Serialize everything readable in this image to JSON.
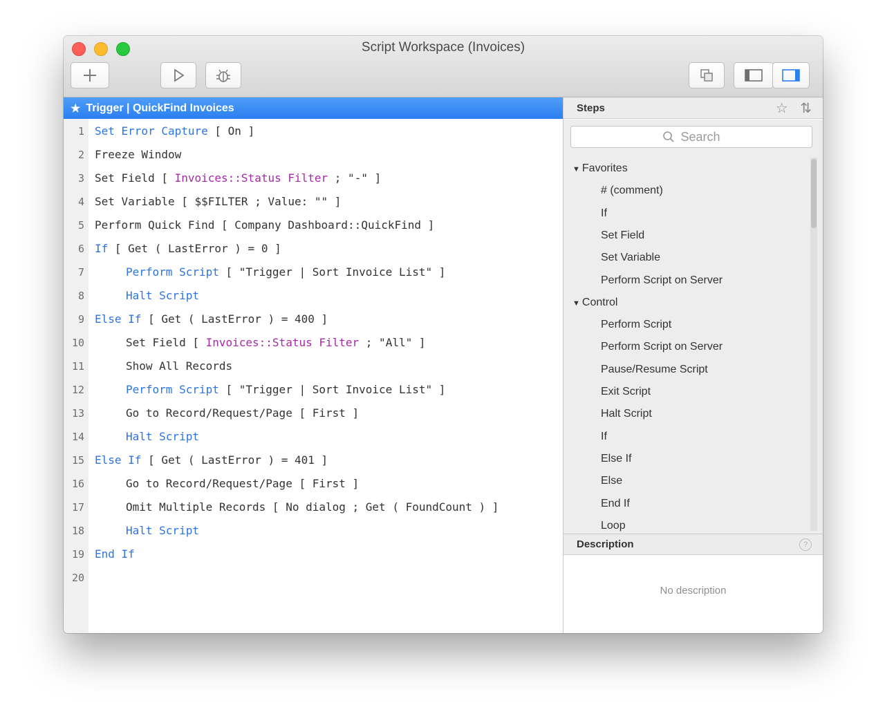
{
  "window": {
    "title": "Script Workspace (Invoices)"
  },
  "toolbar": {
    "new_script_icon": "plus-icon",
    "run_icon": "play-icon",
    "debug_icon": "debug-bug-icon",
    "copy_icon": "copy-icon",
    "left_panel_icon": "left-panel-icon",
    "right_panel_icon": "right-panel-icon"
  },
  "editor": {
    "tab_title": "Trigger | QuickFind Invoices",
    "lines": [
      {
        "n": "1",
        "indent": 0,
        "parts": [
          {
            "t": "Set Error Capture",
            "c": "kw"
          },
          {
            "t": " [ On ]",
            "c": ""
          }
        ]
      },
      {
        "n": "2",
        "indent": 0,
        "parts": [
          {
            "t": "Freeze Window",
            "c": ""
          }
        ]
      },
      {
        "n": "3",
        "indent": 0,
        "parts": [
          {
            "t": "Set Field [ ",
            "c": ""
          },
          {
            "t": "Invoices::Status Filter",
            "c": "fld"
          },
          {
            "t": " ; \"-\" ]",
            "c": ""
          }
        ]
      },
      {
        "n": "4",
        "indent": 0,
        "parts": [
          {
            "t": "Set Variable [ $$FILTER ; Value: \"\" ]",
            "c": ""
          }
        ]
      },
      {
        "n": "5",
        "indent": 0,
        "parts": [
          {
            "t": "Perform Quick Find [ Company Dashboard::QuickFind ]",
            "c": ""
          }
        ]
      },
      {
        "n": "6",
        "indent": 0,
        "parts": [
          {
            "t": "If",
            "c": "kw"
          },
          {
            "t": " [ Get ( LastError ) = 0 ]",
            "c": ""
          }
        ]
      },
      {
        "n": "7",
        "indent": 1,
        "parts": [
          {
            "t": "Perform Script",
            "c": "kw"
          },
          {
            "t": " [ \"Trigger | Sort Invoice List\" ]",
            "c": ""
          }
        ]
      },
      {
        "n": "8",
        "indent": 1,
        "parts": [
          {
            "t": "Halt Script",
            "c": "kw"
          }
        ]
      },
      {
        "n": "9",
        "indent": 0,
        "parts": [
          {
            "t": "Else If",
            "c": "kw"
          },
          {
            "t": " [ Get ( LastError ) = 400 ]",
            "c": ""
          }
        ]
      },
      {
        "n": "10",
        "indent": 1,
        "parts": [
          {
            "t": "Set Field [ ",
            "c": ""
          },
          {
            "t": "Invoices::Status Filter",
            "c": "fld"
          },
          {
            "t": " ; \"All\" ]",
            "c": ""
          }
        ]
      },
      {
        "n": "11",
        "indent": 1,
        "parts": [
          {
            "t": "Show All Records",
            "c": ""
          }
        ]
      },
      {
        "n": "12",
        "indent": 1,
        "parts": [
          {
            "t": "Perform Script",
            "c": "kw"
          },
          {
            "t": " [ \"Trigger | Sort Invoice List\" ]",
            "c": ""
          }
        ]
      },
      {
        "n": "13",
        "indent": 1,
        "parts": [
          {
            "t": "Go to Record/Request/Page [ First ]",
            "c": ""
          }
        ]
      },
      {
        "n": "14",
        "indent": 1,
        "parts": [
          {
            "t": "Halt Script",
            "c": "kw"
          }
        ]
      },
      {
        "n": "15",
        "indent": 0,
        "parts": [
          {
            "t": "Else If",
            "c": "kw"
          },
          {
            "t": " [ Get ( LastError ) = 401 ]",
            "c": ""
          }
        ]
      },
      {
        "n": "16",
        "indent": 1,
        "parts": [
          {
            "t": "Go to Record/Request/Page [ First ]",
            "c": ""
          }
        ]
      },
      {
        "n": "17",
        "indent": 1,
        "parts": [
          {
            "t": "Omit Multiple Records [ No dialog ; Get ( FoundCount ) ]",
            "c": ""
          }
        ]
      },
      {
        "n": "18",
        "indent": 1,
        "parts": [
          {
            "t": "Halt Script",
            "c": "kw"
          }
        ]
      },
      {
        "n": "19",
        "indent": 0,
        "parts": [
          {
            "t": "End If",
            "c": "kw"
          }
        ]
      },
      {
        "n": "20",
        "indent": 0,
        "parts": []
      }
    ]
  },
  "steps": {
    "title": "Steps",
    "search_placeholder": "Search",
    "categories": [
      {
        "name": "Favorites",
        "items": [
          "# (comment)",
          "If",
          "Set Field",
          "Set Variable",
          "Perform Script on Server"
        ]
      },
      {
        "name": "Control",
        "items": [
          "Perform Script",
          "Perform Script on Server",
          "Pause/Resume Script",
          "Exit Script",
          "Halt Script",
          "If",
          "Else If",
          "Else",
          "End If",
          "Loop"
        ]
      }
    ]
  },
  "description": {
    "title": "Description",
    "text": "No description"
  },
  "colors": {
    "keyword": "#2a74e8",
    "field": "#a829a8",
    "header_blue": "#2b7ff0"
  }
}
